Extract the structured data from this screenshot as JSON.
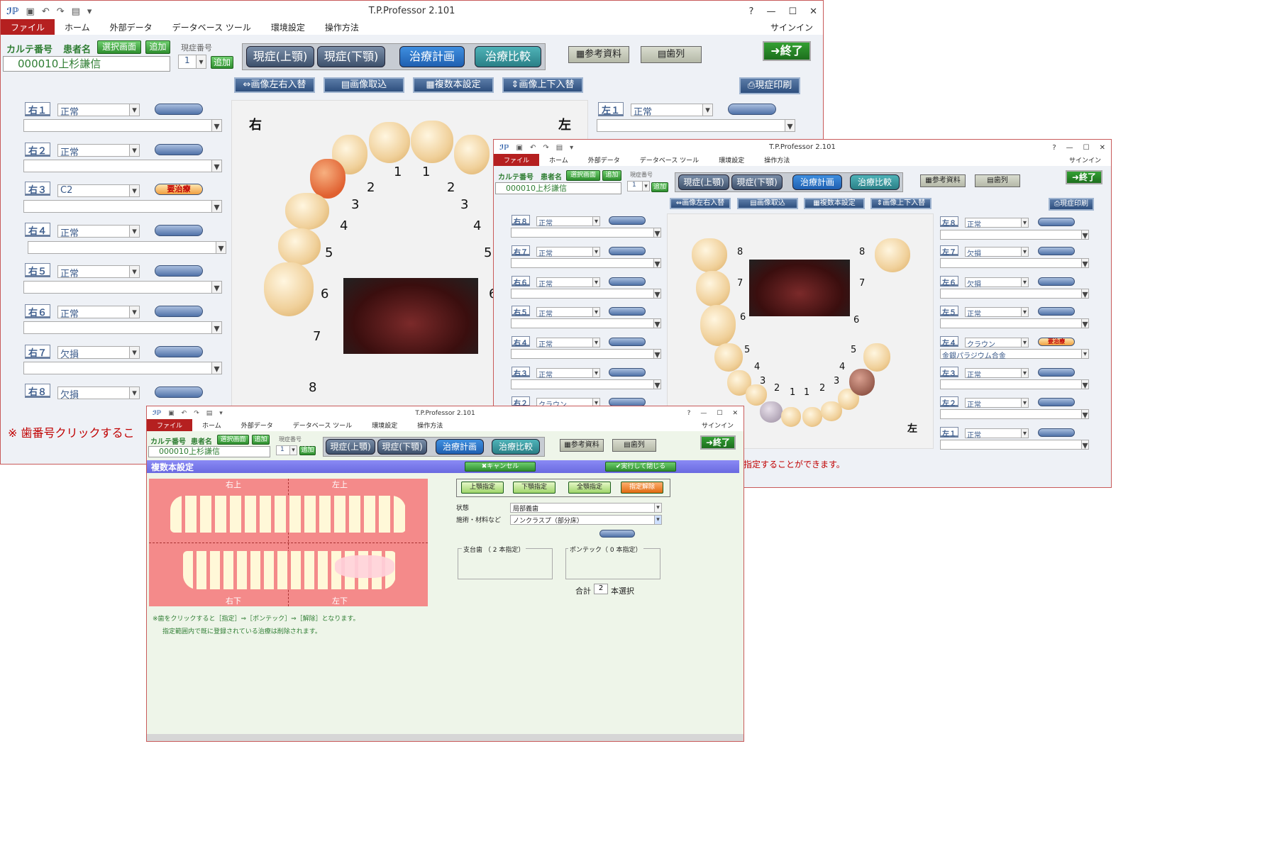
{
  "app_title": "T.P.Professor 2.101",
  "menu": {
    "file": "ファイル",
    "home": "ホーム",
    "external": "外部データ",
    "dbtools": "データベース ツール",
    "env": "環境設定",
    "howto": "操作方法",
    "signin": "サインイン"
  },
  "header": {
    "chart_no_label": "カルテ番号",
    "patient_label": "患者名",
    "select_screen": "選択画面",
    "add": "追加",
    "current_no_label": "現症番号",
    "current_no": "1",
    "add2": "追加",
    "chart_no": "000010",
    "patient": "上杉謙信"
  },
  "tabs": [
    "現症(上顎)",
    "現症(下顎)",
    "治療計画",
    "治療比較"
  ],
  "buttons": {
    "ref": "参考資料",
    "teeth": "歯列",
    "end": "終了",
    "swap_lr": "画像左右入替",
    "import": "画像取込",
    "multi": "複数本設定",
    "swap_ud": "画像上下入替",
    "print": "現症印刷",
    "cancel": "キャンセル",
    "exec_close": "実行して閉じる"
  },
  "win1": {
    "right": [
      {
        "label": "右１",
        "status": "正常"
      },
      {
        "label": "右２",
        "status": "正常"
      },
      {
        "label": "右３",
        "status": "C2",
        "warn": "要治療"
      },
      {
        "label": "右４",
        "status": "正常"
      },
      {
        "label": "右５",
        "status": "正常"
      },
      {
        "label": "右６",
        "status": "正常"
      },
      {
        "label": "右７",
        "status": "欠損"
      },
      {
        "label": "右８",
        "status": "欠損"
      }
    ],
    "left": [
      {
        "label": "左１",
        "status": "正常"
      }
    ],
    "side_right": "右",
    "side_left": "左",
    "nums": [
      "1",
      "1",
      "2",
      "2",
      "3",
      "3",
      "4",
      "4",
      "5",
      "5",
      "6",
      "6",
      "7",
      "8"
    ],
    "note": "※ 歯番号クリックするこ"
  },
  "win2": {
    "right": [
      {
        "label": "右８",
        "status": "正常"
      },
      {
        "label": "右７",
        "status": "正常"
      },
      {
        "label": "右６",
        "status": "正常"
      },
      {
        "label": "右５",
        "status": "正常"
      },
      {
        "label": "右４",
        "status": "正常"
      },
      {
        "label": "右３",
        "status": "正常"
      },
      {
        "label": "右２",
        "status": "クラウン"
      }
    ],
    "left": [
      {
        "label": "左８",
        "status": "正常"
      },
      {
        "label": "左７",
        "status": "欠損"
      },
      {
        "label": "左６",
        "status": "欠損"
      },
      {
        "label": "左５",
        "status": "正常"
      },
      {
        "label": "左４",
        "status": "クラウン",
        "warn": "要治療",
        "material": "金銀パラジウム合金"
      },
      {
        "label": "左３",
        "status": "正常"
      },
      {
        "label": "左２",
        "status": "正常"
      },
      {
        "label": "左１",
        "status": "正常"
      }
    ],
    "side_left": "左",
    "nums": [
      "8",
      "8",
      "7",
      "7",
      "6",
      "6",
      "5",
      "5",
      "4",
      "4",
      "3",
      "3",
      "2",
      "1",
      "1",
      "2"
    ],
    "note": "指定することができます。"
  },
  "win3": {
    "section_title": "複数本設定",
    "quad": {
      "ur": "右上",
      "ul": "左上",
      "lr": "右下",
      "ll": "左下"
    },
    "quick": [
      "上顎指定",
      "下顎指定",
      "全顎指定",
      "指定解除"
    ],
    "state_label": "状態",
    "state_value": "局部義歯",
    "material_label": "施術・材料など",
    "material_value": "ノンクラスプ（部分床）",
    "abutment": "支台歯",
    "abutment_count": "2",
    "abutment_suffix": "本指定）",
    "pontic": "ポンテック（",
    "pontic_count": "0",
    "pontic_suffix": "本指定）",
    "abutment_prefix": "（",
    "total_label": "合計",
    "total_count": "2",
    "total_suffix": "本選択",
    "note1": "※歯をクリックすると［指定］⇒［ポンテック］⇒［解除］となります。",
    "note2": "指定範囲内で既に登録されている治療は削除されます。"
  }
}
